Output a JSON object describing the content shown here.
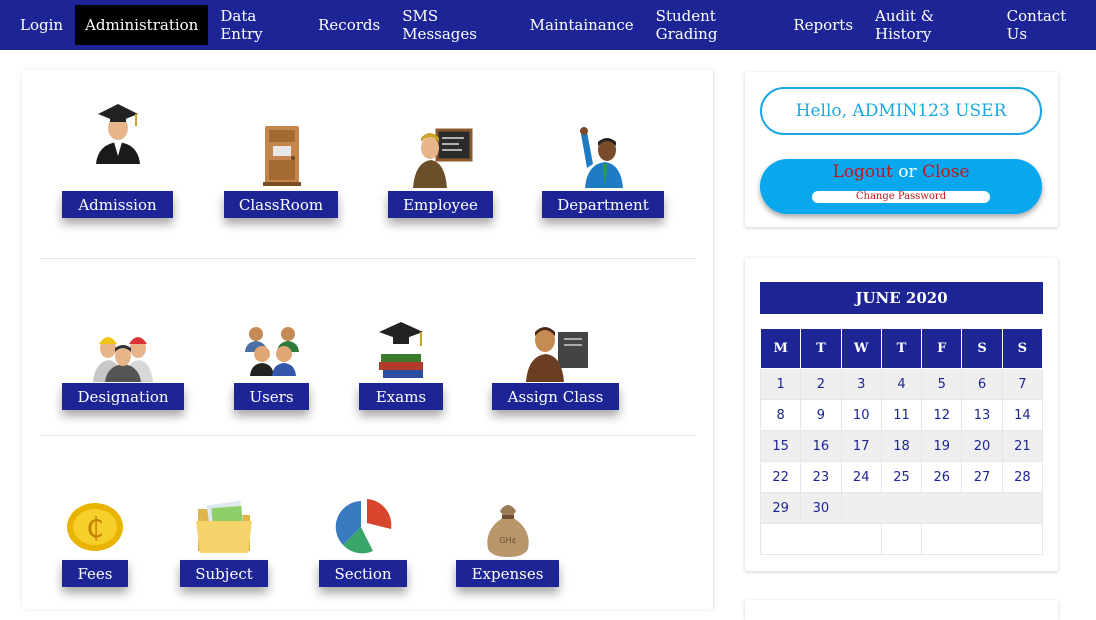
{
  "nav": {
    "items": [
      {
        "label": "Login",
        "active": false
      },
      {
        "label": "Administration",
        "active": true
      },
      {
        "label": "Data Entry",
        "active": false
      },
      {
        "label": "Records",
        "active": false
      },
      {
        "label": "SMS Messages",
        "active": false
      },
      {
        "label": "Maintainance",
        "active": false
      },
      {
        "label": "Student Grading",
        "active": false
      },
      {
        "label": "Reports",
        "active": false
      },
      {
        "label": "Audit & History",
        "active": false
      },
      {
        "label": "Contact Us",
        "active": false
      }
    ]
  },
  "modules": {
    "admission": "Admission",
    "classroom": "ClassRoom",
    "employee": "Employee",
    "department": "Department",
    "designation": "Designation",
    "users": "Users",
    "exams": "Exams",
    "assign_class": "Assign Class",
    "fees": "Fees",
    "subject": "Subject",
    "section": "Section",
    "expenses": "Expenses"
  },
  "user": {
    "greeting": "Hello, ADMIN123 USER",
    "logout": "Logout",
    "or": "or",
    "close": "Close",
    "change_password": "Change Password"
  },
  "calendar": {
    "month": "JUNE 2020",
    "days": [
      "M",
      "T",
      "W",
      "T",
      "F",
      "S",
      "S"
    ],
    "weeks": [
      [
        "1",
        "2",
        "3",
        "4",
        "5",
        "6",
        "7"
      ],
      [
        "8",
        "9",
        "10",
        "11",
        "12",
        "13",
        "14"
      ],
      [
        "15",
        "16",
        "17",
        "18",
        "19",
        "20",
        "21"
      ],
      [
        "22",
        "23",
        "24",
        "25",
        "26",
        "27",
        "28"
      ],
      [
        "29",
        "30",
        "",
        "",
        "",
        "",
        ""
      ]
    ]
  },
  "colors": {
    "nav": "#1d2596",
    "accent": "#09a7ee",
    "link_red": "#c4151c"
  }
}
